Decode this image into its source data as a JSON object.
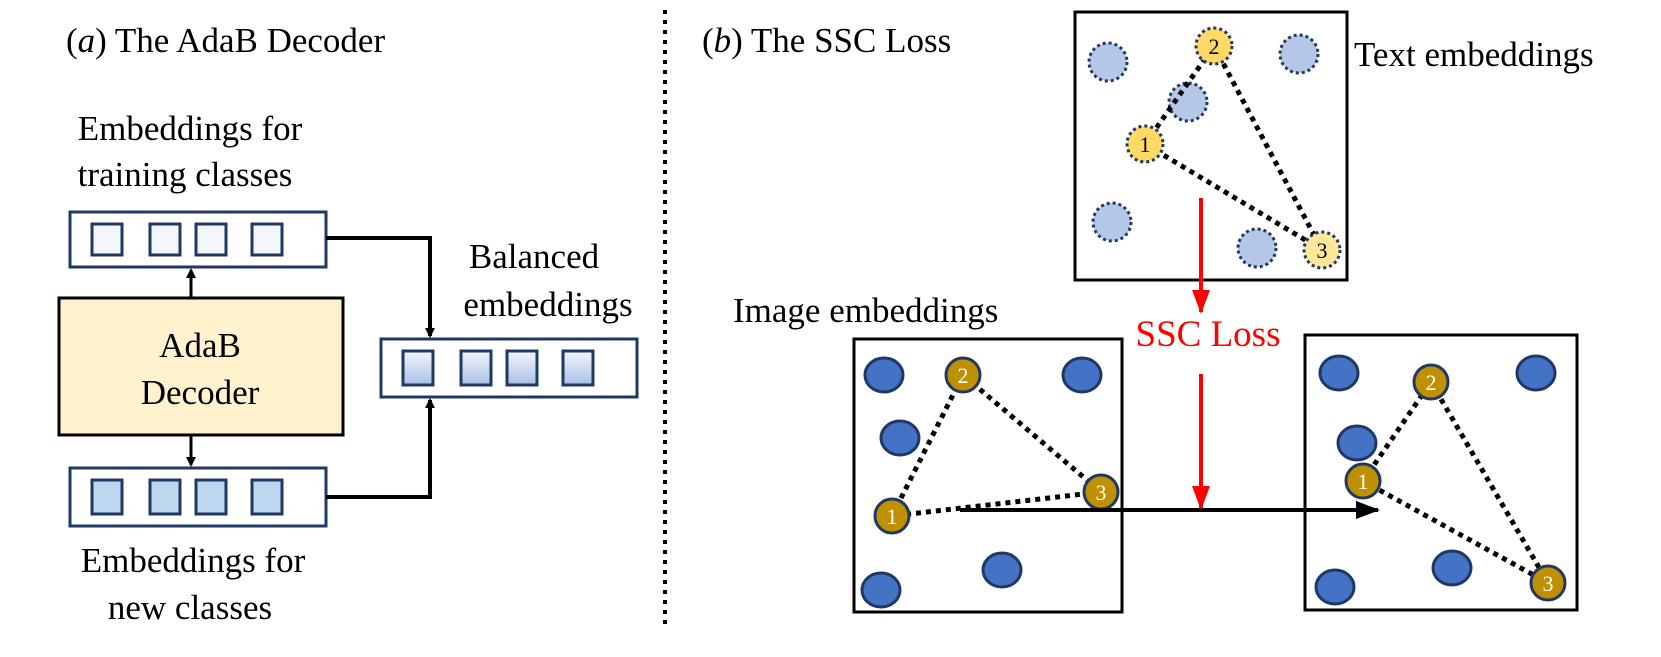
{
  "panel_a": {
    "title_prefix": "(",
    "title_letter": "a",
    "title_rest": ") The AdaB Decoder",
    "top_label_line1": "Embeddings for",
    "top_label_line2": "training classes",
    "decoder_line1": "AdaB",
    "decoder_line2": "Decoder",
    "bottom_label_line1": "Embeddings for",
    "bottom_label_line2": "new classes",
    "balanced_line1": "Balanced",
    "balanced_line2": "embeddings",
    "slots_per_vector": 4,
    "colors": {
      "decoder_fill": "#fff2cc",
      "vector_border": "#1f3864",
      "training_slot_fill": "#f4f6fb",
      "new_slot_fill": "#bdd7ee",
      "balanced_slot_top": "#f4f6fb",
      "balanced_slot_bottom": "#a9c0e4"
    }
  },
  "panel_b": {
    "title_prefix": "(",
    "title_letter": "b",
    "title_rest": ") The SSC Loss",
    "text_embeddings_label": "Text embeddings",
    "image_embeddings_label": "Image embeddings",
    "loss_label": "SSC Loss",
    "anchor_numbers": [
      "1",
      "2",
      "3"
    ],
    "colors": {
      "loss": "#ff0000",
      "text_point_fill": "#b4c7e7",
      "text_anchor_fill": "#ffd966",
      "text_anchor3_fill": "#ffe699",
      "point_border": "#203864",
      "image_point_fill": "#4472c4",
      "image_anchor_fill": "#bf9000"
    }
  }
}
